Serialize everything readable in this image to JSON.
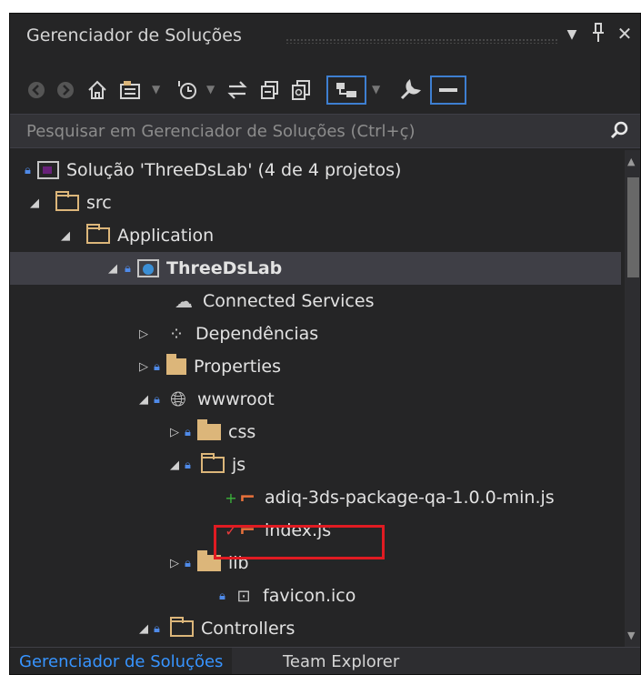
{
  "window": {
    "title": "Gerenciador de Soluções",
    "dropdown_icon": "▼",
    "pin_icon": "ᵖ",
    "close_icon": "✕"
  },
  "toolbar": {
    "icons": [
      "back-icon",
      "forward-icon",
      "home-icon",
      "switch-views-icon",
      "pending-changes-filter-icon",
      "sync-icon",
      "collapse-all-icon",
      "show-all-files-icon",
      "preview-selected-icon",
      "properties-icon",
      "minimize-icon"
    ]
  },
  "search": {
    "placeholder": "Pesquisar em Gerenciador de Soluções (Ctrl+ç)"
  },
  "tree": [
    {
      "label": "Solução 'ThreeDsLab' (4 de 4 projetos)"
    },
    {
      "label": "src"
    },
    {
      "label": "Application"
    },
    {
      "label": "ThreeDsLab"
    },
    {
      "label": "Connected Services"
    },
    {
      "label": "Dependências"
    },
    {
      "label": "Properties"
    },
    {
      "label": "wwwroot"
    },
    {
      "label": "css"
    },
    {
      "label": "js"
    },
    {
      "label": "adiq-3ds-package-qa-1.0.0-min.js"
    },
    {
      "label": "index.js"
    },
    {
      "label": "lib"
    },
    {
      "label": "favicon.ico"
    },
    {
      "label": "Controllers"
    }
  ],
  "tabs": [
    {
      "label": "Gerenciador de Soluções"
    },
    {
      "label": "Team Explorer"
    }
  ],
  "colors": {
    "background": "#252526",
    "highlight_box": "#e01b22",
    "active_tab": "#3794ff",
    "folder": "#dcb67a"
  }
}
